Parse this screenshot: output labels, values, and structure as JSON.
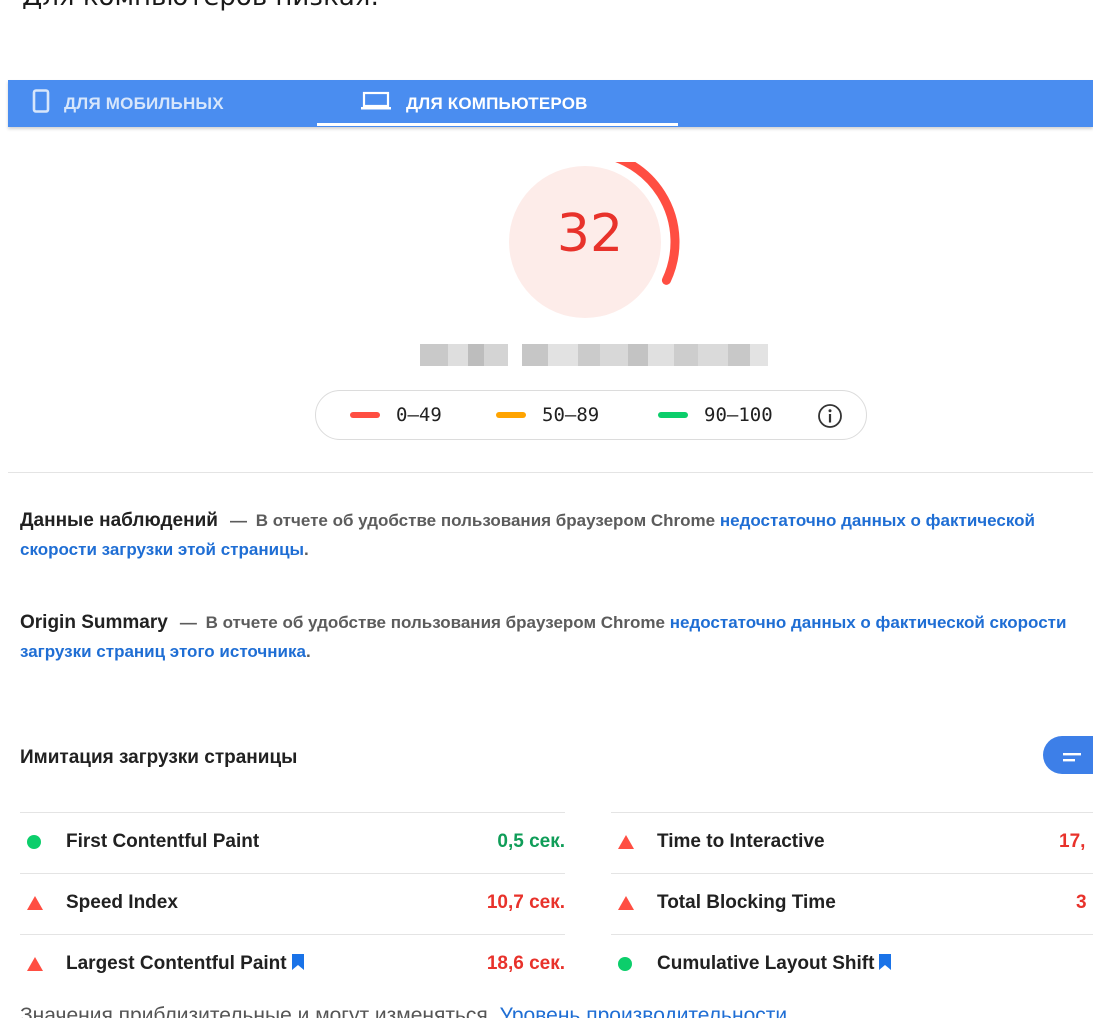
{
  "header": {
    "title": "Для компьютеров низкая:"
  },
  "tabs": [
    {
      "label": "ДЛЯ МОБИЛЬНЫХ",
      "icon": "phone-icon",
      "selected": false
    },
    {
      "label": "ДЛЯ КОМПЬЮТЕРОВ",
      "icon": "laptop-icon",
      "selected": true
    }
  ],
  "score": {
    "value": "32",
    "fraction": 0.32,
    "color": "#e8322b",
    "bg": "#fdece9"
  },
  "legend": {
    "items": [
      {
        "range": "0–49",
        "color": "#ff4e42"
      },
      {
        "range": "50–89",
        "color": "#ffa400"
      },
      {
        "range": "90–100",
        "color": "#0cce6b"
      }
    ],
    "info_icon": "info-icon"
  },
  "field_data": {
    "title": "Данные наблюдений",
    "dash": "—",
    "text": "В отчете об удобстве пользования браузером Chrome",
    "link": "недостаточно данных о фактической скорости загрузки этой страницы",
    "end": "."
  },
  "origin_summary": {
    "title": "Origin Summary",
    "dash": "—",
    "text": "В отчете об удобстве пользования браузером Chrome",
    "link": "недостаточно данных о фактической скорости загрузки страниц этого источника",
    "end": "."
  },
  "lab": {
    "title": "Имитация загрузки страницы",
    "toggle_icon": "list-toggle-icon",
    "metrics_left": [
      {
        "name": "First Contentful Paint",
        "value": "0,5 сек.",
        "status": "good",
        "bookmark": false
      },
      {
        "name": "Speed Index",
        "value": "10,7 сек.",
        "status": "poor",
        "bookmark": false
      },
      {
        "name": "Largest Contentful Paint",
        "value": "18,6 сек.",
        "status": "poor",
        "bookmark": true
      }
    ],
    "metrics_right": [
      {
        "name": "Time to Interactive",
        "value": "17,",
        "status": "poor",
        "bookmark": false
      },
      {
        "name": "Total Blocking Time",
        "value": "3",
        "status": "poor",
        "bookmark": false
      },
      {
        "name": "Cumulative Layout Shift",
        "value": "",
        "status": "good",
        "bookmark": true
      }
    ]
  },
  "footer": {
    "text": "Значения приблизительные и могут изменяться.",
    "link": "Уровень производительности"
  }
}
